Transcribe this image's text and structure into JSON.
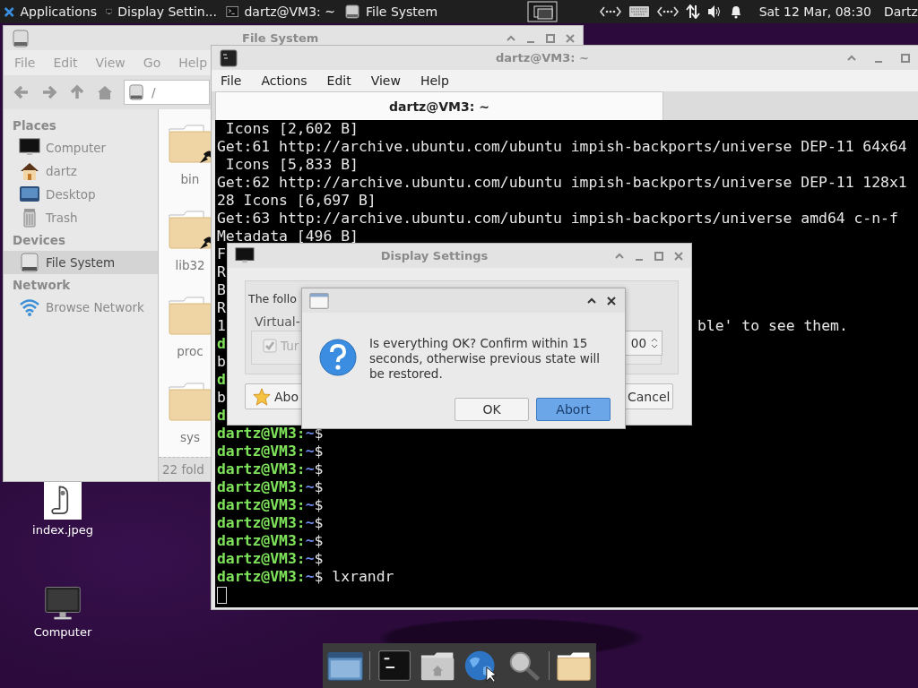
{
  "top_panel": {
    "menu_label": "Applications",
    "tasks": [
      {
        "label": "Display Settin..."
      },
      {
        "label": "dartz@VM3: ~"
      },
      {
        "label": "File System"
      }
    ],
    "clock": "Sat 12 Mar, 08:30",
    "user": "Dartz"
  },
  "desktop_icons": [
    {
      "label": "index.jpeg",
      "kind": "picture"
    },
    {
      "label": "Computer",
      "kind": "computer"
    }
  ],
  "file_manager": {
    "title": "File System",
    "menu": [
      "File",
      "Edit",
      "View",
      "Go",
      "Help"
    ],
    "path": "/",
    "sidebar": [
      {
        "heading": "Places",
        "items": [
          {
            "label": "Computer",
            "kind": "computer",
            "selected": false
          },
          {
            "label": "dartz",
            "kind": "home",
            "selected": false
          },
          {
            "label": "Desktop",
            "kind": "desktop",
            "selected": false
          },
          {
            "label": "Trash",
            "kind": "trash",
            "selected": false
          }
        ]
      },
      {
        "heading": "Devices",
        "items": [
          {
            "label": "File System",
            "kind": "drive",
            "selected": true
          }
        ]
      },
      {
        "heading": "Network",
        "items": [
          {
            "label": "Browse Network",
            "kind": "network",
            "selected": false
          }
        ]
      }
    ],
    "files": [
      {
        "name": "bin",
        "link": true
      },
      {
        "name": "lib32",
        "link": true
      },
      {
        "name": "proc",
        "link": false
      },
      {
        "name": "sys",
        "link": false
      }
    ],
    "status": "22 fold"
  },
  "terminal": {
    "title": "dartz@VM3: ~",
    "menu": [
      "File",
      "Actions",
      "Edit",
      "View",
      "Help"
    ],
    "tab": "dartz@VM3: ~",
    "lines": [
      {
        "segments": [
          {
            "text": " Icons [2,602 B]",
            "kind": "plain"
          }
        ]
      },
      {
        "segments": [
          {
            "text": "Get:61 http://archive.ubuntu.com/ubuntu impish-backports/universe DEP-11 64x64",
            "kind": "plain"
          }
        ]
      },
      {
        "segments": [
          {
            "text": " Icons [5,833 B]",
            "kind": "plain"
          }
        ]
      },
      {
        "segments": [
          {
            "text": "Get:62 http://archive.ubuntu.com/ubuntu impish-backports/universe DEP-11 128x1",
            "kind": "plain"
          }
        ]
      },
      {
        "segments": [
          {
            "text": "28 Icons [6,697 B]",
            "kind": "plain"
          }
        ]
      },
      {
        "segments": [
          {
            "text": "Get:63 http://archive.ubuntu.com/ubuntu impish-backports/universe amd64 c-n-f",
            "kind": "plain"
          }
        ]
      },
      {
        "segments": [
          {
            "text": "Metadata [496 B]",
            "kind": "plain"
          }
        ]
      },
      {
        "segments": [
          {
            "text": "F",
            "kind": "plain"
          }
        ]
      },
      {
        "segments": [
          {
            "text": "R",
            "kind": "plain"
          }
        ]
      },
      {
        "segments": [
          {
            "text": "B",
            "kind": "plain"
          }
        ]
      },
      {
        "segments": [
          {
            "text": "R",
            "kind": "plain"
          }
        ]
      },
      {
        "segments": [
          {
            "text": "1",
            "kind": "plain"
          }
        ],
        "aside": "ble' to see them."
      },
      {
        "segments": [
          {
            "text": "d",
            "kind": "user"
          }
        ]
      },
      {
        "segments": [
          {
            "text": "b",
            "kind": "plain"
          }
        ]
      },
      {
        "segments": [
          {
            "text": "d",
            "kind": "user"
          }
        ]
      },
      {
        "segments": [
          {
            "text": "b",
            "kind": "plain"
          }
        ]
      },
      {
        "segments": [
          {
            "text": "d",
            "kind": "user"
          }
        ]
      },
      {
        "segments": [
          {
            "text": "dartz@VM3:",
            "kind": "user"
          },
          {
            "text": "~",
            "kind": "path"
          },
          {
            "text": "$",
            "kind": "plain"
          }
        ]
      },
      {
        "segments": [
          {
            "text": "dartz@VM3:",
            "kind": "user"
          },
          {
            "text": "~",
            "kind": "path"
          },
          {
            "text": "$",
            "kind": "plain"
          }
        ]
      },
      {
        "segments": [
          {
            "text": "dartz@VM3:",
            "kind": "user"
          },
          {
            "text": "~",
            "kind": "path"
          },
          {
            "text": "$",
            "kind": "plain"
          }
        ]
      },
      {
        "segments": [
          {
            "text": "dartz@VM3:",
            "kind": "user"
          },
          {
            "text": "~",
            "kind": "path"
          },
          {
            "text": "$",
            "kind": "plain"
          }
        ]
      },
      {
        "segments": [
          {
            "text": "dartz@VM3:",
            "kind": "user"
          },
          {
            "text": "~",
            "kind": "path"
          },
          {
            "text": "$",
            "kind": "plain"
          }
        ]
      },
      {
        "segments": [
          {
            "text": "dartz@VM3:",
            "kind": "user"
          },
          {
            "text": "~",
            "kind": "path"
          },
          {
            "text": "$",
            "kind": "plain"
          }
        ]
      },
      {
        "segments": [
          {
            "text": "dartz@VM3:",
            "kind": "user"
          },
          {
            "text": "~",
            "kind": "path"
          },
          {
            "text": "$",
            "kind": "plain"
          }
        ]
      },
      {
        "segments": [
          {
            "text": "dartz@VM3:",
            "kind": "user"
          },
          {
            "text": "~",
            "kind": "path"
          },
          {
            "text": "$",
            "kind": "plain"
          }
        ]
      },
      {
        "segments": [
          {
            "text": "dartz@VM3:",
            "kind": "user"
          },
          {
            "text": "~",
            "kind": "path"
          },
          {
            "text": "$ lxrandr",
            "kind": "plain"
          }
        ]
      }
    ],
    "cursor": true
  },
  "display_settings": {
    "title": "Display Settings",
    "intro": "The follo",
    "group": "Virtual-",
    "checkbox": {
      "label": "Tur",
      "checked": true
    },
    "spin_value": "00",
    "buttons": [
      "Abo",
      "Cancel"
    ]
  },
  "confirm_dialog": {
    "message": "Is everything OK? Confirm within 15 seconds, otherwise previous state will be restored.",
    "buttons": [
      {
        "label": "OK",
        "default": false
      },
      {
        "label": "Abort",
        "default": true
      }
    ]
  },
  "dock": {
    "items": [
      {
        "kind": "window"
      },
      {
        "kind": "separator"
      },
      {
        "kind": "terminal"
      },
      {
        "kind": "home"
      },
      {
        "kind": "globe"
      },
      {
        "kind": "search"
      },
      {
        "kind": "separator"
      },
      {
        "kind": "folder"
      }
    ]
  }
}
